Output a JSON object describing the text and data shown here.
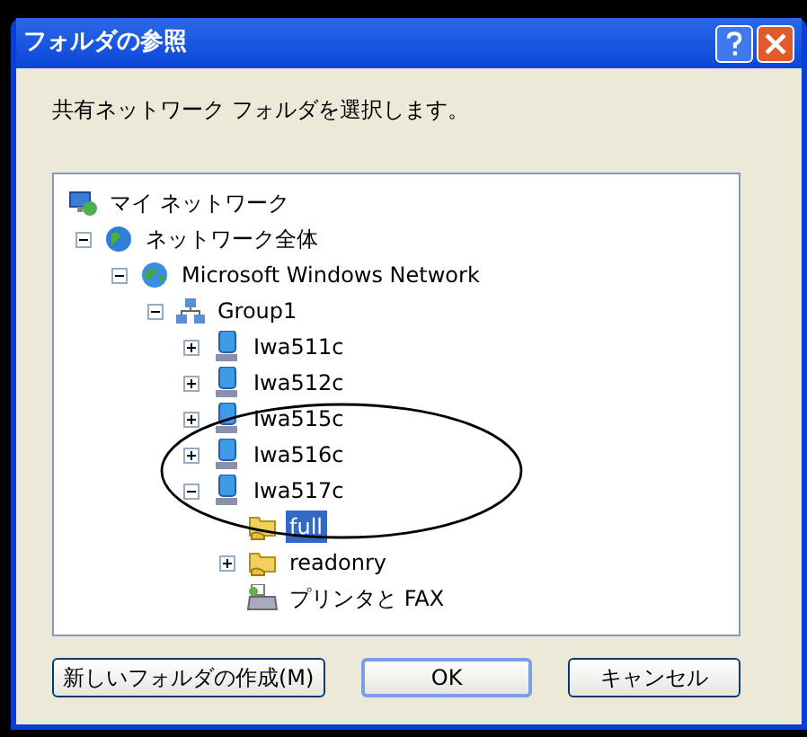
{
  "window": {
    "title": "フォルダの参照"
  },
  "prompt": "共有ネットワーク フォルダを選択します。",
  "tree": [
    {
      "label": "マイ ネットワーク",
      "kind": "network",
      "selected": false,
      "children": [
        {
          "label": "ネットワーク全体",
          "kind": "globe",
          "expandable": true,
          "expanded": true,
          "selected": false,
          "children": [
            {
              "label": "Microsoft Windows Network",
              "kind": "domain",
              "expandable": true,
              "expanded": true,
              "selected": false,
              "children": [
                {
                  "label": "Group1",
                  "kind": "workgroup",
                  "expandable": true,
                  "expanded": true,
                  "selected": false,
                  "children": [
                    {
                      "label": "Iwa511c",
                      "kind": "computer",
                      "expandable": true,
                      "expanded": false,
                      "selected": false
                    },
                    {
                      "label": "Iwa512c",
                      "kind": "computer",
                      "expandable": true,
                      "expanded": false,
                      "selected": false
                    },
                    {
                      "label": "Iwa515c",
                      "kind": "computer",
                      "expandable": true,
                      "expanded": false,
                      "selected": false
                    },
                    {
                      "label": "Iwa516c",
                      "kind": "computer",
                      "expandable": true,
                      "expanded": false,
                      "selected": false
                    },
                    {
                      "label": "Iwa517c",
                      "kind": "computer",
                      "expandable": true,
                      "expanded": true,
                      "selected": false,
                      "children": [
                        {
                          "label": "full",
                          "kind": "share",
                          "expandable": false,
                          "selected": true
                        },
                        {
                          "label": "readonry",
                          "kind": "share",
                          "expandable": true,
                          "expanded": false,
                          "selected": false
                        },
                        {
                          "label": "プリンタと FAX",
                          "kind": "printers",
                          "expandable": false,
                          "selected": false
                        }
                      ]
                    }
                  ]
                }
              ]
            }
          ]
        }
      ]
    }
  ],
  "buttons": [
    {
      "label": "新しいフォルダの作成(M)",
      "default": false
    },
    {
      "label": "OK",
      "default": true
    },
    {
      "label": "キャンセル",
      "default": false
    }
  ]
}
